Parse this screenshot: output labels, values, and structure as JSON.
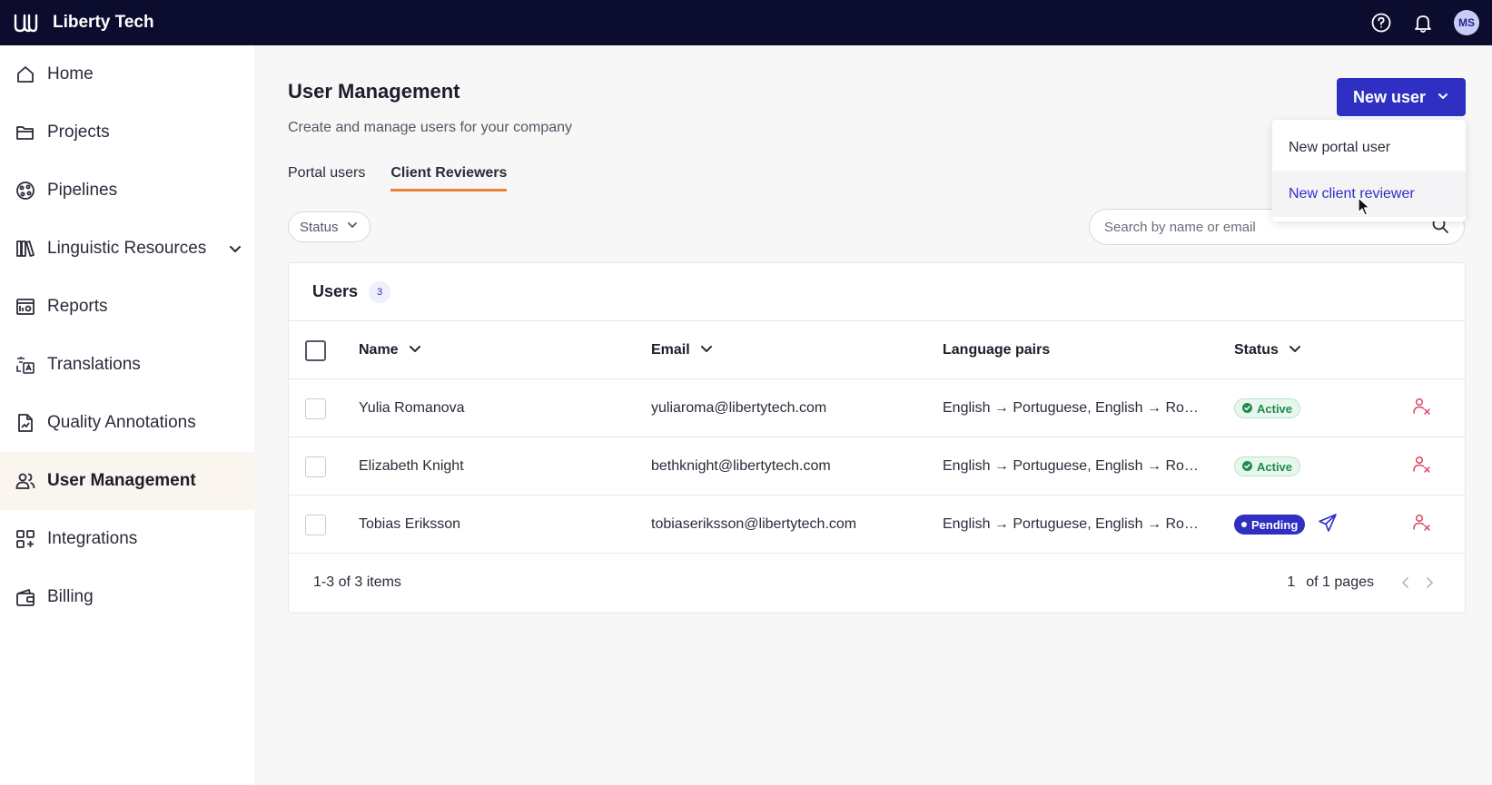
{
  "app": {
    "brand": "Liberty Tech",
    "avatar_initials": "MS"
  },
  "sidebar": {
    "items": [
      {
        "label": "Home",
        "icon": "home-icon"
      },
      {
        "label": "Projects",
        "icon": "folder-icon"
      },
      {
        "label": "Pipelines",
        "icon": "pipelines-icon"
      },
      {
        "label": "Linguistic Resources",
        "icon": "books-icon",
        "expandable": true
      },
      {
        "label": "Reports",
        "icon": "report-icon"
      },
      {
        "label": "Translations",
        "icon": "translate-icon"
      },
      {
        "label": "Quality Annotations",
        "icon": "annotation-icon"
      },
      {
        "label": "User Management",
        "icon": "users-icon",
        "active": true
      },
      {
        "label": "Integrations",
        "icon": "grid-plus-icon"
      },
      {
        "label": "Billing",
        "icon": "wallet-icon"
      }
    ]
  },
  "page": {
    "title": "User Management",
    "subtitle": "Create and manage users for your company"
  },
  "tabs": [
    {
      "label": "Portal users",
      "active": false
    },
    {
      "label": "Client Reviewers",
      "active": true
    }
  ],
  "filters": {
    "status_label": "Status"
  },
  "search": {
    "placeholder": "Search by name or email",
    "value": ""
  },
  "new_user": {
    "label": "New user",
    "menu": [
      {
        "label": "New portal user"
      },
      {
        "label": "New client reviewer",
        "hovered": true
      }
    ]
  },
  "table": {
    "title": "Users",
    "count": "3",
    "columns": {
      "name": "Name",
      "email": "Email",
      "language_pairs": "Language pairs",
      "status": "Status"
    },
    "rows": [
      {
        "name": "Yulia Romanova",
        "email": "yuliaroma@libertytech.com",
        "language_pairs": "English → Portuguese, English → Romanian",
        "status": "Active"
      },
      {
        "name": "Elizabeth Knight",
        "email": "bethknight@libertytech.com",
        "language_pairs": "English → Portuguese, English → Romanian",
        "status": "Active"
      },
      {
        "name": "Tobias Eriksson",
        "email": "tobiaseriksson@libertytech.com",
        "language_pairs": "English → Portuguese, English → Romanian",
        "status": "Pending"
      }
    ],
    "footer": {
      "range": "1-3 of 3 items",
      "page": "1",
      "of_pages": "of 1 pages"
    }
  },
  "colors": {
    "topbar": "#0b0c2e",
    "primary": "#2f2fc4",
    "tab_accent": "#ee7f3a",
    "active_badge": "#1f8a4c",
    "danger_icon": "#d9465f"
  }
}
